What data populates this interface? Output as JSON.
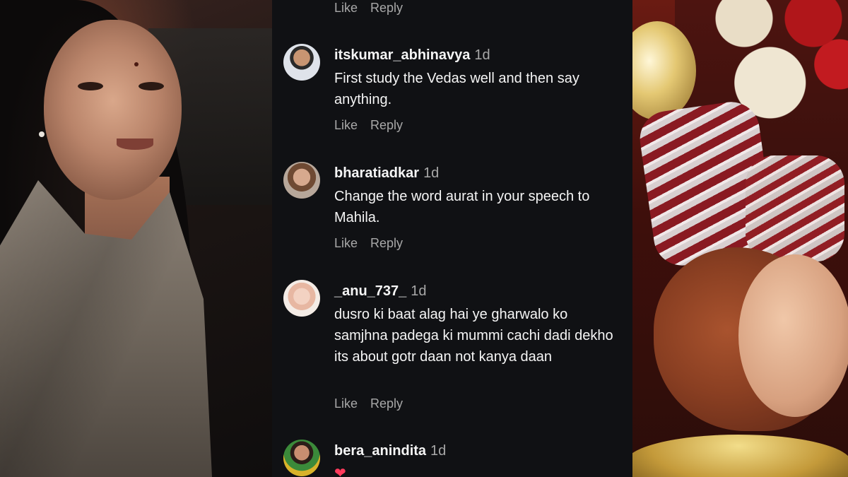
{
  "comments": [
    {
      "username": "itskumar_abhinavya",
      "time": "1d",
      "text": "First study the Vedas well and then say anything.",
      "like_label": "Like",
      "reply_label": "Reply"
    },
    {
      "username": "bharatiadkar",
      "time": "1d",
      "text": "Change the word aurat in your speech to Mahila.",
      "like_label": "Like",
      "reply_label": "Reply"
    },
    {
      "username": "_anu_737_",
      "time": "1d",
      "text": "dusro ki baat alag hai ye gharwalo ko samjhna padega ki mummi cachi dadi dekho its about gotr daan not kanya daan",
      "like_label": "Like",
      "reply_label": "Reply"
    },
    {
      "username": "bera_anindita",
      "time": "1d",
      "emoji": "❤"
    }
  ],
  "top_actions": {
    "like_label": "Like",
    "reply_label": "Reply"
  },
  "colors": {
    "background": "#101114",
    "text": "#f5f5f5",
    "muted": "#a8a8a8",
    "heart": "#ff3b5c"
  },
  "icons": [
    "heart-emoji"
  ]
}
